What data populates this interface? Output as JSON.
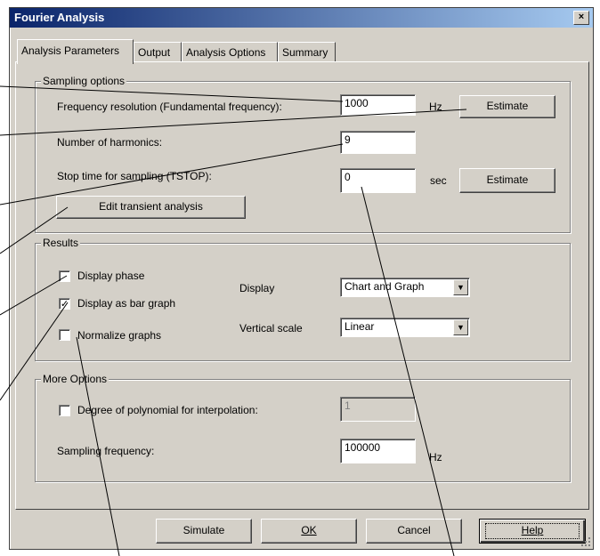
{
  "window": {
    "title": "Fourier Analysis",
    "close_glyph": "×"
  },
  "tabs": [
    {
      "label": "Analysis Parameters"
    },
    {
      "label": "Output"
    },
    {
      "label": "Analysis Options"
    },
    {
      "label": "Summary"
    }
  ],
  "sampling": {
    "legend": "Sampling options",
    "freq_label": "Frequency resolution (Fundamental frequency):",
    "freq_value": "1000",
    "freq_unit": "Hz",
    "estimate_label": "Estimate",
    "harmonics_label": "Number of harmonics:",
    "harmonics_value": "9",
    "stop_label": "Stop time for sampling (TSTOP):",
    "stop_value": "0",
    "stop_unit": "sec",
    "estimate2_label": "Estimate",
    "edit_transient_label": "Edit transient analysis"
  },
  "results": {
    "legend": "Results",
    "display_phase": {
      "label": "Display phase",
      "checked": false
    },
    "display_bar": {
      "label": "Display as bar graph",
      "checked": true
    },
    "normalize": {
      "label": "Normalize graphs",
      "checked": false
    },
    "display_label": "Display",
    "display_value": "Chart and Graph",
    "vscale_label": "Vertical scale",
    "vscale_value": "Linear",
    "dropdown_glyph": "▼",
    "check_glyph": "✓"
  },
  "more": {
    "legend": "More Options",
    "degree": {
      "label": "Degree of polynomial for interpolation:",
      "checked": false
    },
    "degree_value": "1",
    "sampling_freq_label": "Sampling frequency:",
    "sampling_freq_value": "100000",
    "sampling_freq_unit": "Hz"
  },
  "buttons": {
    "simulate": "Simulate",
    "ok": "OK",
    "cancel": "Cancel",
    "help": "Help"
  }
}
